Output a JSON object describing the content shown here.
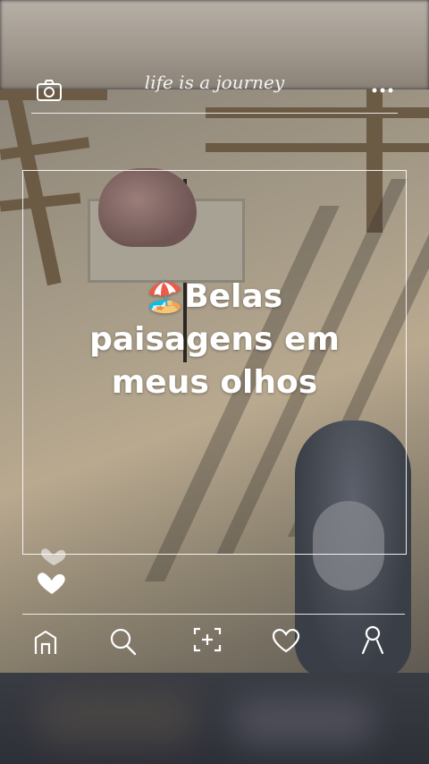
{
  "header": {
    "title": "life is a journey",
    "left_icon": "camera-icon",
    "right_icon": "more-dots-icon"
  },
  "post": {
    "emoji": "🏖️",
    "caption": "Belas paisagens em meus olhos"
  },
  "hearts": {
    "icon": "hearts-icon"
  },
  "toolbar": {
    "items": [
      {
        "icon": "home-icon"
      },
      {
        "icon": "search-icon"
      },
      {
        "icon": "add-icon"
      },
      {
        "icon": "heart-icon"
      },
      {
        "icon": "profile-icon"
      }
    ]
  },
  "colors": {
    "overlay": "#ffffff",
    "bottom_band": "#2e3038"
  }
}
